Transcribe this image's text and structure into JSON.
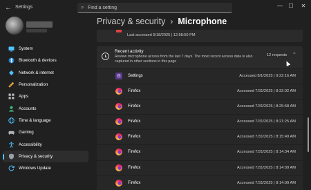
{
  "window": {
    "title": "Settings",
    "back_icon": "back-arrow-icon",
    "minimize": "—",
    "maximize": "☐",
    "close": "✕"
  },
  "search": {
    "placeholder": "Find a setting",
    "value": ""
  },
  "sidebar": {
    "items": [
      {
        "label": "System",
        "icon": "system-icon",
        "color": "#4cc2ff"
      },
      {
        "label": "Bluetooth & devices",
        "icon": "bluetooth-icon",
        "color": "#4cc2ff"
      },
      {
        "label": "Network & internet",
        "icon": "network-icon",
        "color": "#4cc2ff"
      },
      {
        "label": "Personalization",
        "icon": "brush-icon",
        "color": "#e8a33d"
      },
      {
        "label": "Apps",
        "icon": "apps-icon",
        "color": "#9aa0a6"
      },
      {
        "label": "Accounts",
        "icon": "accounts-icon",
        "color": "#3fbf7f"
      },
      {
        "label": "Time & language",
        "icon": "globe-icon",
        "color": "#4cc2ff"
      },
      {
        "label": "Gaming",
        "icon": "gamepad-icon",
        "color": "#9aa0a6"
      },
      {
        "label": "Accessibility",
        "icon": "accessibility-icon",
        "color": "#4cc2ff"
      },
      {
        "label": "Privacy & security",
        "icon": "shield-icon",
        "color": "#9aa0a6",
        "active": true
      },
      {
        "label": "Windows Update",
        "icon": "windows-update-icon",
        "color": "#4cc2ff"
      }
    ]
  },
  "breadcrumb": {
    "parent": "Privacy & security",
    "separator": "›",
    "current": "Microphone"
  },
  "last_accessed": {
    "text": "Last accessed 5/18/2025  |  12:58:50 PM"
  },
  "recent_activity": {
    "title": "Recent activity",
    "description": "Review microphone access from the last 7 days. The most recent access data is also captured in other sections in this page",
    "count": "12 requests",
    "chevron": "⌃"
  },
  "rows": [
    {
      "app": "Settings",
      "time": "Accessed 8/1/2025   |   9:22:16 AM",
      "icon": "settings-icon"
    },
    {
      "app": "Firefox",
      "time": "Accessed 7/31/2025   |   8:32:02 AM",
      "icon": "firefox-icon"
    },
    {
      "app": "Firefox",
      "time": "Accessed 7/31/2025   |   8:25:58 AM",
      "icon": "firefox-icon"
    },
    {
      "app": "Firefox",
      "time": "Accessed 7/31/2025   |   8:21:25 AM",
      "icon": "firefox-icon"
    },
    {
      "app": "Firefox",
      "time": "Accessed 7/31/2025   |   8:15:49 AM",
      "icon": "firefox-icon"
    },
    {
      "app": "Firefox",
      "time": "Accessed 7/31/2025   |   8:14:34 AM",
      "icon": "firefox-icon"
    },
    {
      "app": "Firefox",
      "time": "Accessed 7/31/2025   |   8:14:09 AM",
      "icon": "firefox-icon"
    },
    {
      "app": "Firefox",
      "time": "Accessed 7/31/2025   |   8:14:09 AM",
      "icon": "firefox-icon"
    }
  ],
  "colors": {
    "accent": "#4cc2ff",
    "background": "#202020",
    "card": "#2b2b2b"
  }
}
